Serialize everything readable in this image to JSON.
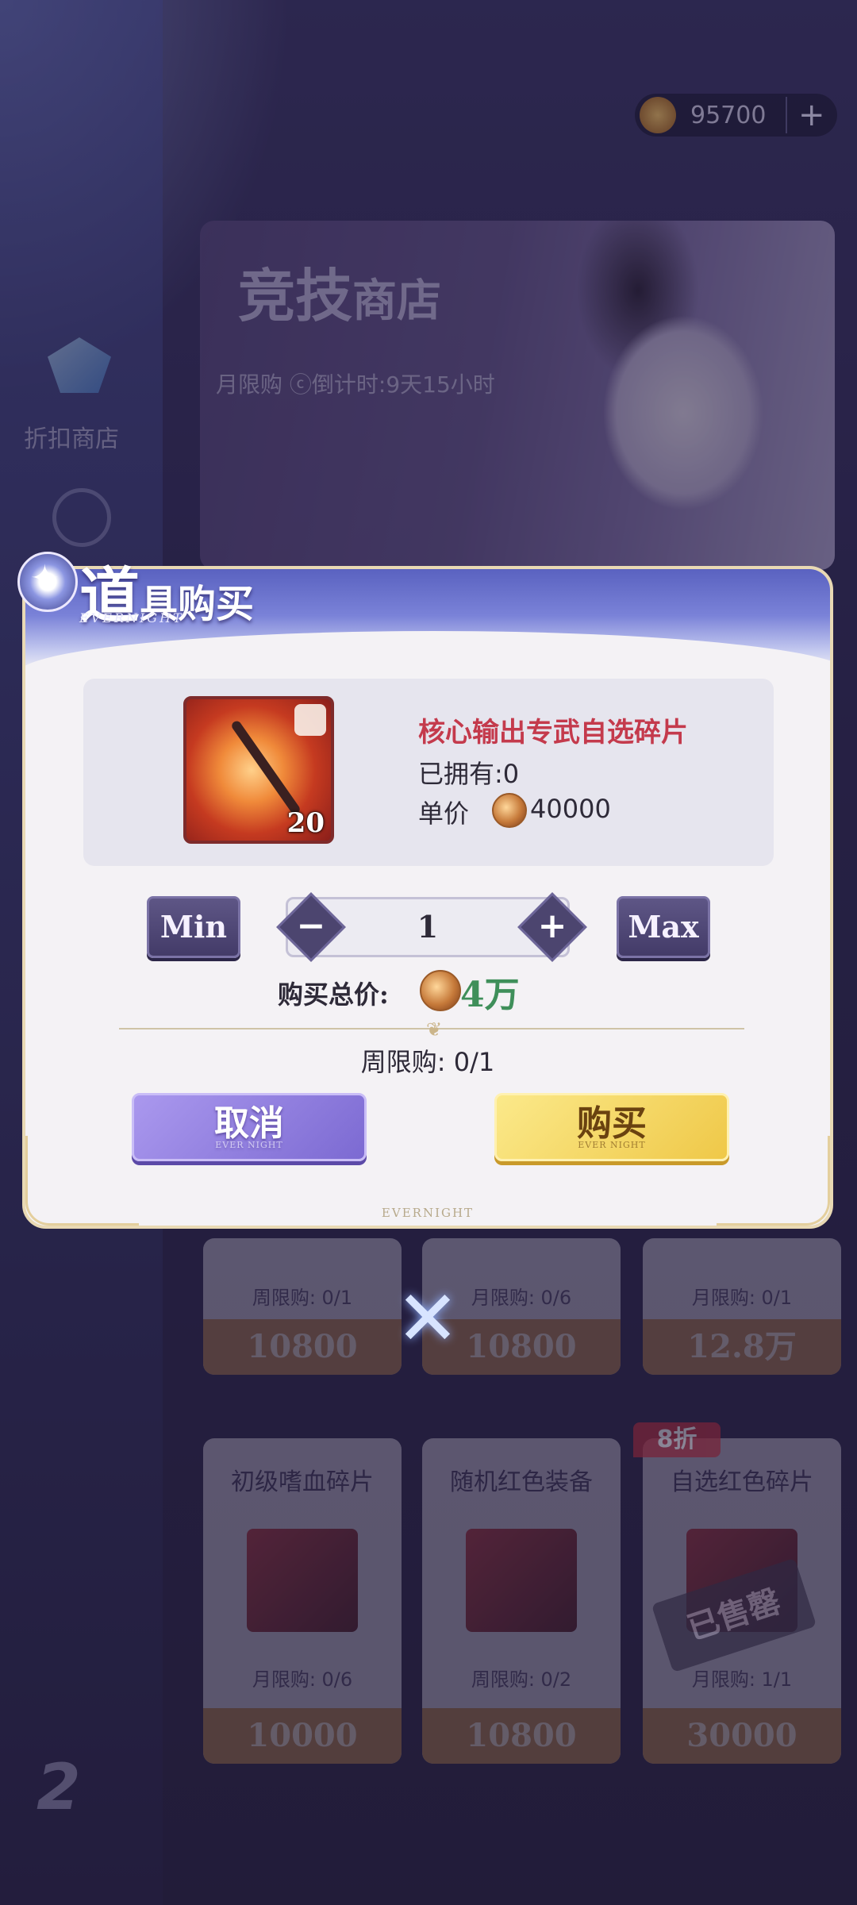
{
  "background": {
    "currency": {
      "amount": "95700",
      "plus": "+",
      "icon": "medal-coin-icon"
    },
    "nav": {
      "discount_shop_label": "折扣商店"
    },
    "banner": {
      "title_main": "竞技",
      "title_small": "商店",
      "subtitle": "月限购 ⓒ倒计时:9天15小时"
    },
    "cards_row1": [
      {
        "limit": "周限购: 0/1",
        "price": "10800"
      },
      {
        "limit": "月限购: 0/6",
        "price": "10800"
      },
      {
        "limit": "月限购: 0/1",
        "price": "12.8万"
      }
    ],
    "cards_row2": [
      {
        "name": "初级嗜血碎片",
        "limit": "月限购: 0/6",
        "price": "10000"
      },
      {
        "name": "随机红色装备",
        "limit": "周限购: 0/2",
        "price": "10800"
      },
      {
        "name": "自选红色碎片",
        "limit": "月限购: 1/1",
        "price": "30000"
      }
    ],
    "discount_badge": "8折",
    "sold_out": "已售罄"
  },
  "dialog": {
    "title_big": "道",
    "title_rest": "具购买",
    "subtitle": "EVERNIGHT",
    "item": {
      "name": "核心输出专武自选碎片",
      "owned": "已拥有:0",
      "unit_label": "单价",
      "unit_price": "40000",
      "count": "20",
      "icon": "weapon-fragment-icon"
    },
    "quantity": {
      "min_label": "Min",
      "max_label": "Max",
      "value": "1",
      "minus": "−",
      "plus": "+"
    },
    "total": {
      "label": "购买总价:",
      "value": "4万"
    },
    "weekly_limit": "周限购: 0/1",
    "cancel": {
      "label": "取消",
      "sub": "EVER NIGHT"
    },
    "buy": {
      "label": "购买",
      "sub": "EVER NIGHT"
    },
    "brand": "EVERNIGHT"
  },
  "colors": {
    "accent": "#c43a4c",
    "total": "#3f8f5a",
    "buy": "#f3d35a",
    "cancel": "#8e7ddf"
  }
}
